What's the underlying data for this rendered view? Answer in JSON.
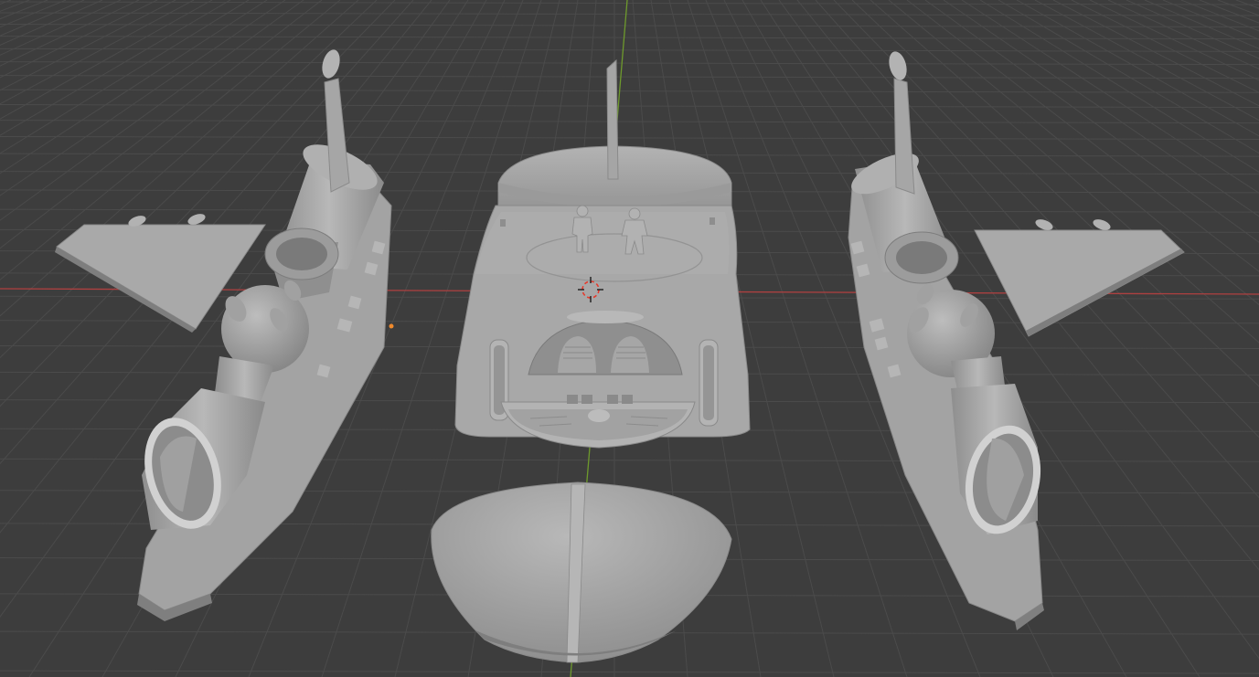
{
  "viewport": {
    "background": "#3d3d3d",
    "grid_color": "#4a4a4a",
    "x_axis_color": "#c04545",
    "y_axis_color": "#6f9a2f",
    "model_color": "#a8a8a8",
    "model_shadow": "#7c7c7c",
    "model_highlight": "#c9c9c9",
    "cursor_color": "#e8382c"
  },
  "scene": {
    "objects": [
      "left-wing",
      "left-pod",
      "main-body",
      "pilot-figure-left",
      "pilot-figure-right",
      "nose-cone",
      "right-pod",
      "right-wing"
    ]
  }
}
